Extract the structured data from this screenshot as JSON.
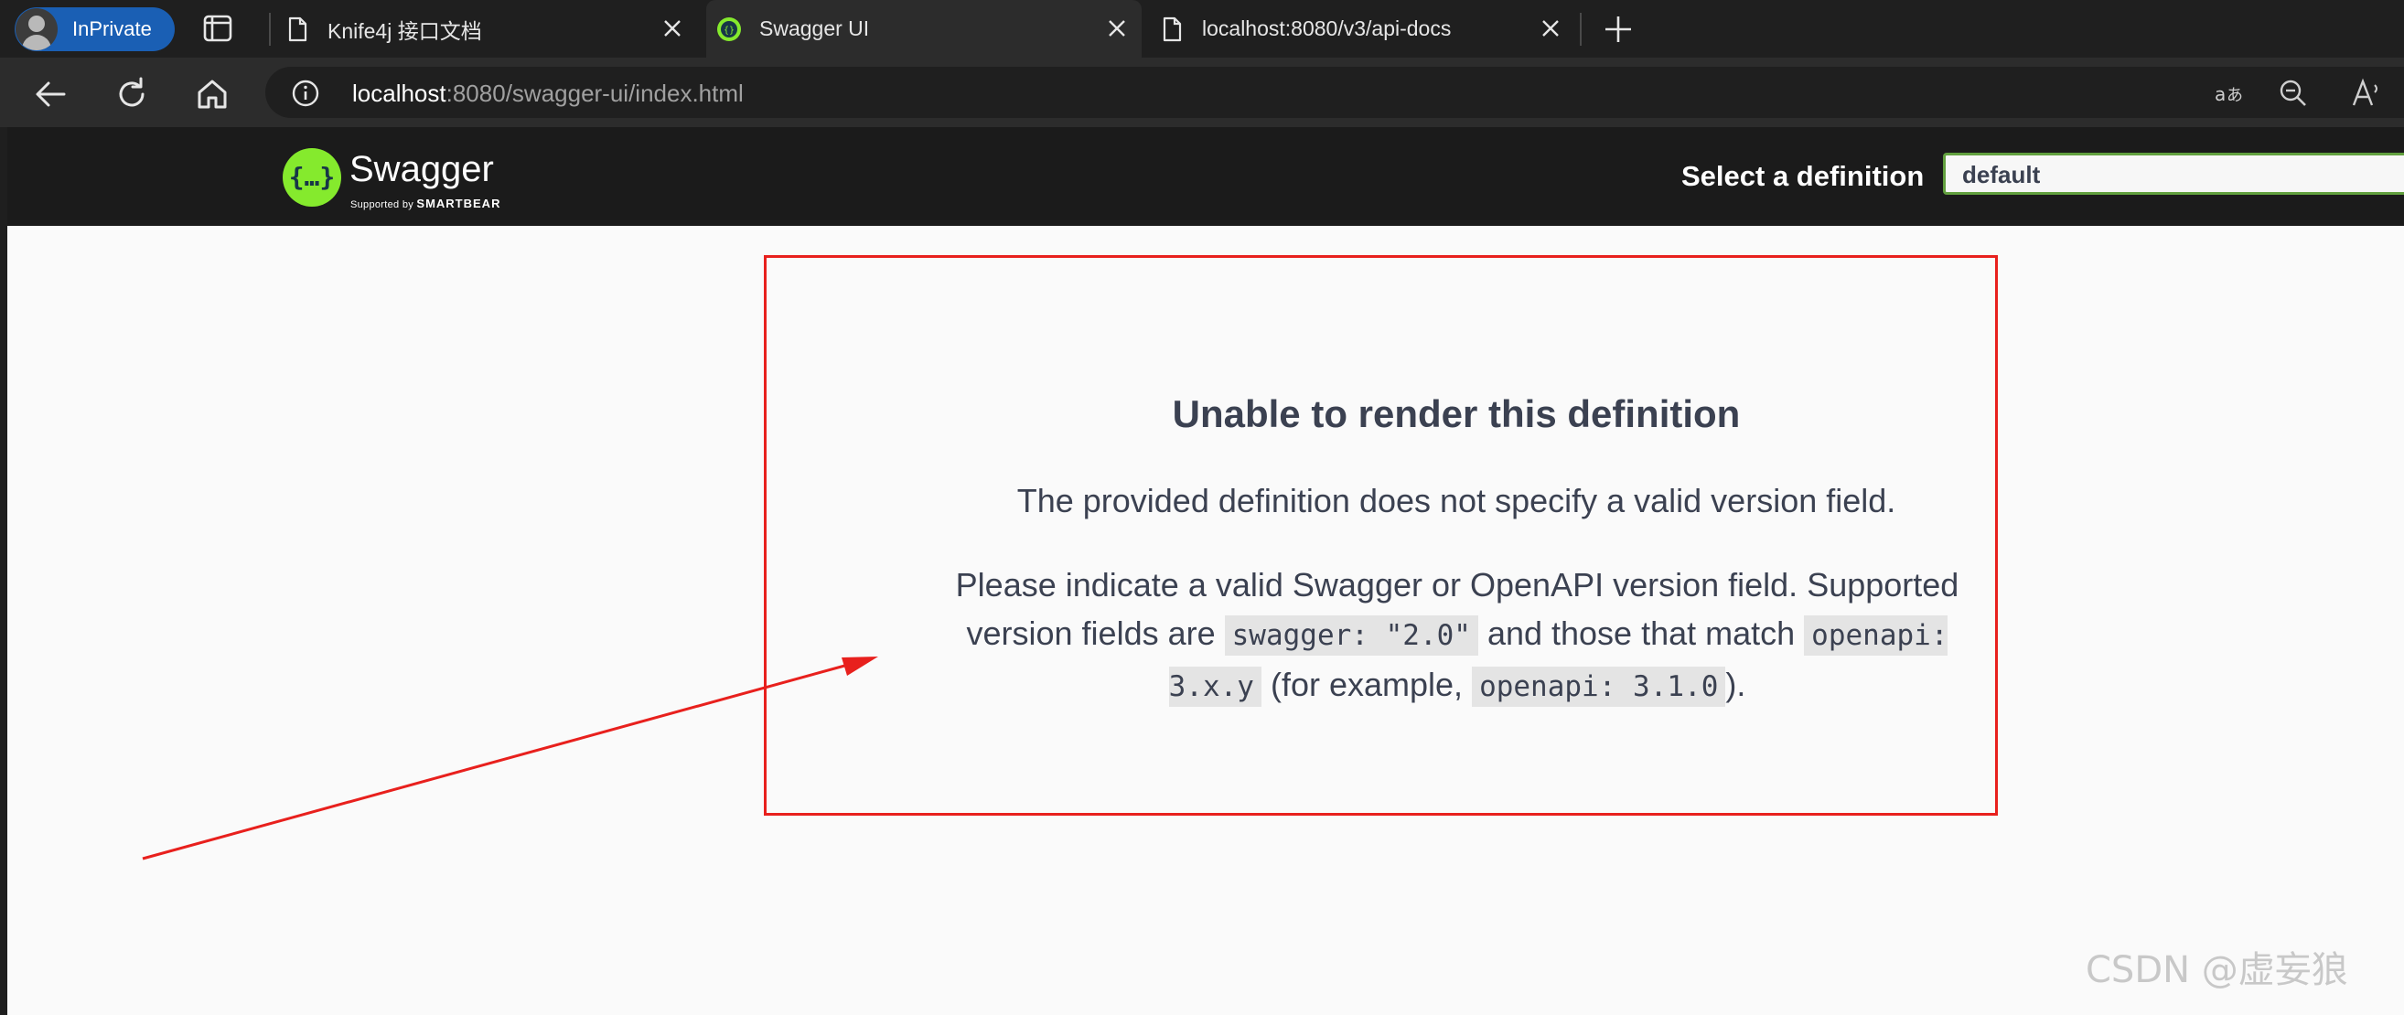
{
  "browser": {
    "profile_label": "InPrivate",
    "tabs": [
      {
        "title": "Knife4j 接口文档",
        "active": false
      },
      {
        "title": "Swagger UI",
        "active": true
      },
      {
        "title": "localhost:8080/v3/api-docs",
        "active": false
      }
    ],
    "address": {
      "host": "localhost",
      "rest": ":8080/swagger-ui/index.html"
    }
  },
  "swagger": {
    "brand": "Swagger",
    "supported_by": "Supported by",
    "smartbear": "SMARTBEAR",
    "select_label": "Select a definition",
    "select_value": "default"
  },
  "error": {
    "title": "Unable to render this definition",
    "line1": "The provided definition does not specify a valid version field.",
    "para_part1": "Please indicate a valid Swagger or OpenAPI version field. Supported version fields are ",
    "code1": "swagger: \"2.0\"",
    "para_part2": " and those that match ",
    "code2": "openapi: 3.x.y",
    "para_part3": " (for example, ",
    "code3": "openapi: 3.1.0",
    "para_part4": ")."
  },
  "annotation": {
    "color": "#e8201d"
  },
  "watermark": "CSDN @虚妄狼",
  "colors": {
    "swagger_green": "#85ea2d",
    "select_border": "#62a03f",
    "inprivate_blue": "#1a5fb4"
  }
}
